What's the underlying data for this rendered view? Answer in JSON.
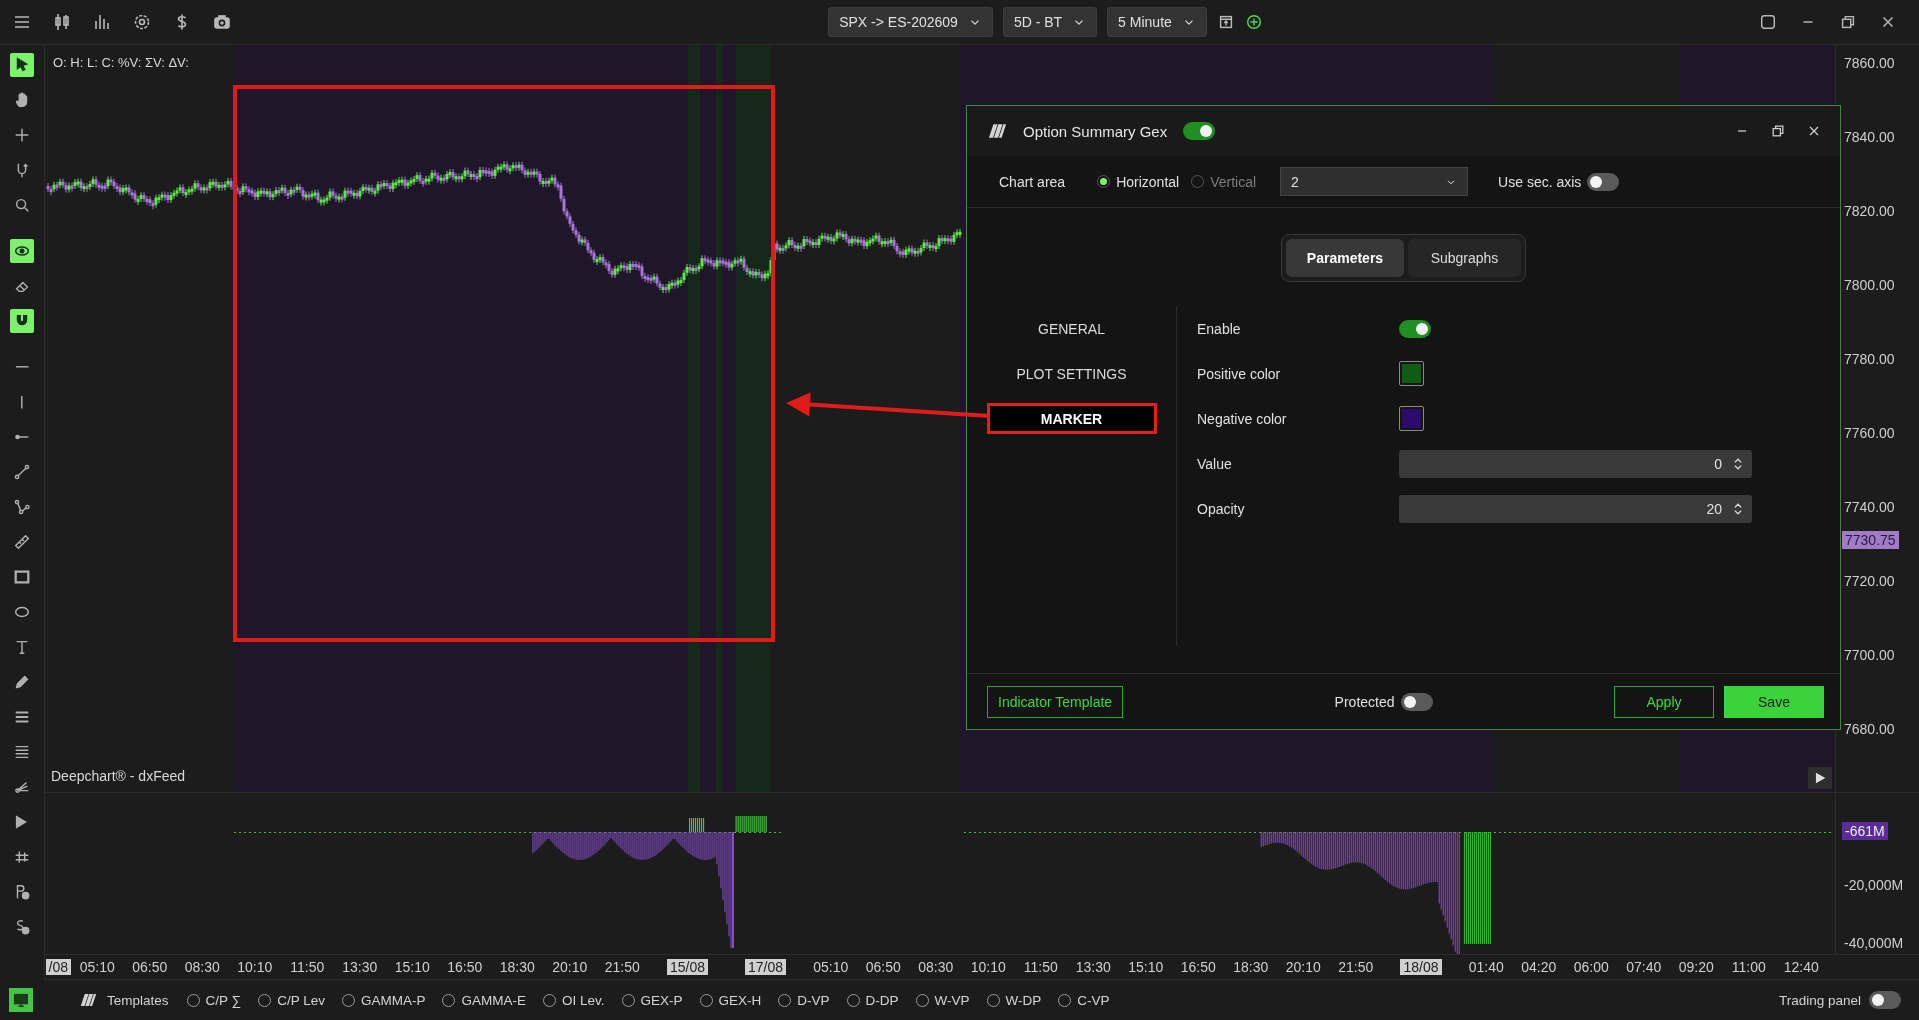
{
  "top_bar": {
    "icons": [
      {
        "kind": "menu"
      },
      {
        "kind": "candles"
      },
      {
        "kind": "bars"
      },
      {
        "kind": "settings"
      },
      {
        "kind": "dollar"
      },
      {
        "kind": "camera"
      }
    ],
    "dropdowns": [
      "SPX -> ES-202609",
      "5D - BT",
      "5 Minute"
    ],
    "actions": [
      {
        "kind": "window"
      },
      {
        "kind": "add"
      }
    ],
    "window_controls": [
      {
        "kind": "layout"
      },
      {
        "kind": "minimize"
      },
      {
        "kind": "restore"
      },
      {
        "kind": "close"
      }
    ]
  },
  "tool_groups": [
    {
      "tools": [
        {
          "kind": "cursor",
          "on": true
        },
        {
          "kind": "hand",
          "on": false
        },
        {
          "kind": "crosshair",
          "on": false
        },
        {
          "kind": "hook",
          "on": false
        },
        {
          "kind": "zoom",
          "on": false
        }
      ]
    },
    {
      "tools": [
        {
          "kind": "eye",
          "on": true
        },
        {
          "kind": "eraser",
          "on": false
        },
        {
          "kind": "magnet",
          "on": true
        }
      ]
    },
    {
      "tools": [
        {
          "kind": "hline",
          "on": false
        },
        {
          "kind": "vline",
          "on": false
        },
        {
          "kind": "ray",
          "on": false
        },
        {
          "kind": "segment",
          "on": false
        },
        {
          "kind": "path",
          "on": false
        },
        {
          "kind": "ruler",
          "on": false
        },
        {
          "kind": "rectangle",
          "on": false
        },
        {
          "kind": "ellipse",
          "on": false
        },
        {
          "kind": "text",
          "on": false
        },
        {
          "kind": "pencil",
          "on": false
        },
        {
          "kind": "lines3",
          "on": false
        },
        {
          "kind": "lines4",
          "on": false
        },
        {
          "kind": "fan",
          "on": false
        },
        {
          "kind": "flag",
          "on": false
        },
        {
          "kind": "levels",
          "on": false
        },
        {
          "kind": "coin_p",
          "on": false
        },
        {
          "kind": "coin_s",
          "on": false
        }
      ]
    }
  ],
  "chart": {
    "legend": "O: H: L: C: %V: ΣV: ΔV:",
    "source": "Deepchart® - dxFeed",
    "price_axis": [
      "7860.00",
      "7840.00",
      "7820.00",
      "7800.00",
      "7780.00",
      "7760.00",
      "7740.00",
      "7720.00",
      "7700.00",
      "7680.00"
    ],
    "last_price": "7730.75",
    "indicator_badge": "-661M",
    "indicator_axis": [
      "-20,000M",
      "-40,000M"
    ],
    "time_axis": [
      {
        "label": "/08",
        "date": true
      },
      {
        "label": "05:10",
        "date": false
      },
      {
        "label": "06:50",
        "date": false
      },
      {
        "label": "08:30",
        "date": false
      },
      {
        "label": "10:10",
        "date": false
      },
      {
        "label": "11:50",
        "date": false
      },
      {
        "label": "13:30",
        "date": false
      },
      {
        "label": "15:10",
        "date": false
      },
      {
        "label": "16:50",
        "date": false
      },
      {
        "label": "18:30",
        "date": false
      },
      {
        "label": "20:10",
        "date": false
      },
      {
        "label": "21:50",
        "date": false
      },
      {
        "label": "15/08",
        "date": true
      },
      {
        "label": "17/08",
        "date": true
      },
      {
        "label": "05:10",
        "date": false
      },
      {
        "label": "06:50",
        "date": false
      },
      {
        "label": "08:30",
        "date": false
      },
      {
        "label": "10:10",
        "date": false
      },
      {
        "label": "11:50",
        "date": false
      },
      {
        "label": "13:30",
        "date": false
      },
      {
        "label": "15:10",
        "date": false
      },
      {
        "label": "16:50",
        "date": false
      },
      {
        "label": "18:30",
        "date": false
      },
      {
        "label": "20:10",
        "date": false
      },
      {
        "label": "21:50",
        "date": false
      },
      {
        "label": "18/08",
        "date": true
      },
      {
        "label": "01:40",
        "date": false
      },
      {
        "label": "04:20",
        "date": false
      },
      {
        "label": "06:00",
        "date": false
      },
      {
        "label": "07:40",
        "date": false
      },
      {
        "label": "09:20",
        "date": false
      },
      {
        "label": "11:00",
        "date": false
      },
      {
        "label": "12:40",
        "date": false
      }
    ]
  },
  "markup": [
    {
      "kind": "rectangle"
    },
    {
      "kind": "arrow"
    }
  ],
  "dialog": {
    "title": "Option Summary Gex",
    "enabled": true,
    "chart_area": {
      "label": "Chart area",
      "options": [
        {
          "label": "Horizontal",
          "selected": true
        },
        {
          "label": "Vertical",
          "selected": false
        }
      ],
      "select": "2",
      "secondary_axis": {
        "label": "Use sec. axis",
        "on": false
      }
    },
    "tabs": [
      {
        "label": "Parameters",
        "selected": true
      },
      {
        "label": "Subgraphs",
        "selected": false
      }
    ],
    "nav": [
      {
        "label": "GENERAL",
        "selected": false,
        "highlighted": false
      },
      {
        "label": "PLOT SETTINGS",
        "selected": false,
        "highlighted": false
      },
      {
        "label": "MARKER",
        "selected": true,
        "highlighted": true
      }
    ],
    "fields": [
      {
        "label": "Enable",
        "kind": "toggle",
        "on": true
      },
      {
        "label": "Positive color",
        "kind": "color",
        "color": "#0f5c16"
      },
      {
        "label": "Negative color",
        "kind": "color",
        "color": "#2c0c6a"
      },
      {
        "label": "Value",
        "kind": "number",
        "value": "0"
      },
      {
        "label": "Opacity",
        "kind": "number",
        "value": "20"
      }
    ],
    "footer": {
      "template": "Indicator Template",
      "protected": {
        "label": "Protected",
        "on": false
      },
      "apply": "Apply",
      "save": "Save"
    }
  },
  "bottom_bar": {
    "layout_on": true,
    "templates": "Templates",
    "studies": [
      {
        "label": "C/P ∑",
        "selected": false
      },
      {
        "label": "C/P Lev",
        "selected": false
      },
      {
        "label": "GAMMA-P",
        "selected": false
      },
      {
        "label": "GAMMA-E",
        "selected": false
      },
      {
        "label": "OI Lev.",
        "selected": false
      },
      {
        "label": "GEX-P",
        "selected": false
      },
      {
        "label": "GEX-H",
        "selected": false
      },
      {
        "label": "D-VP",
        "selected": false
      },
      {
        "label": "D-DP",
        "selected": false
      },
      {
        "label": "W-VP",
        "selected": false
      },
      {
        "label": "W-DP",
        "selected": false
      },
      {
        "label": "C-VP",
        "selected": false
      }
    ],
    "trading_panel": {
      "label": "Trading panel",
      "on": false
    }
  }
}
